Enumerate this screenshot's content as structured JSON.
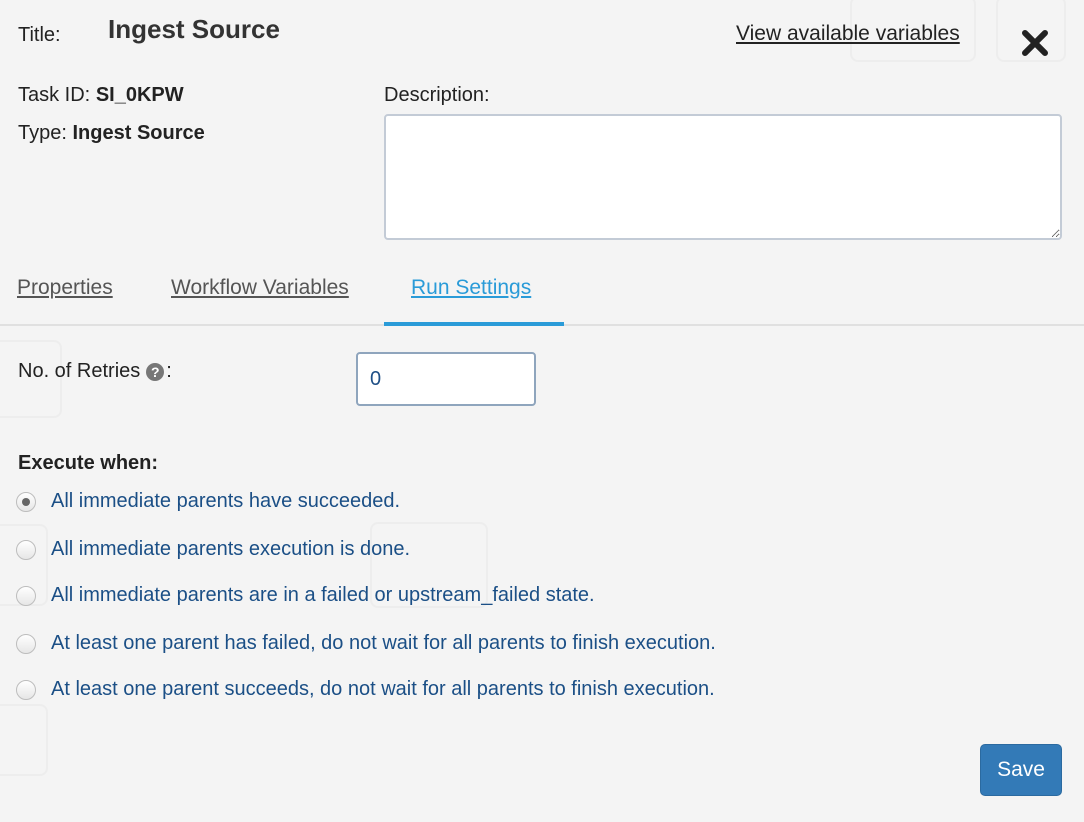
{
  "header": {
    "title_label": "Title:",
    "title_value": "Ingest Source",
    "view_variables_link": "View available variables"
  },
  "meta": {
    "task_id_label": "Task ID:",
    "task_id_value": "SI_0KPW",
    "type_label": "Type:",
    "type_value": "Ingest Source"
  },
  "description": {
    "label": "Description:",
    "value": ""
  },
  "tabs": [
    {
      "label": "Properties",
      "active": false
    },
    {
      "label": "Workflow Variables",
      "active": false
    },
    {
      "label": "Run Settings",
      "active": true
    }
  ],
  "run_settings": {
    "retries_label": "No. of Retries",
    "retries_suffix": ":",
    "retries_help_icon": "question-circle-icon",
    "retries_value": "0",
    "execute_when_label": "Execute when:",
    "options": [
      {
        "label": "All immediate parents have succeeded.",
        "checked": true
      },
      {
        "label": "All immediate parents execution is done.",
        "checked": false
      },
      {
        "label": "All immediate parents are in a failed or upstream_failed state.",
        "checked": false
      },
      {
        "label": "At least one parent has failed, do not wait for all parents to finish execution.",
        "checked": false
      },
      {
        "label": "At least one parent succeeds, do not wait for all parents to finish execution.",
        "checked": false
      }
    ]
  },
  "footer": {
    "save_label": "Save"
  },
  "colors": {
    "accent": "#2a9bd8",
    "option_text": "#1b4f86",
    "save_button": "#337ab7"
  }
}
